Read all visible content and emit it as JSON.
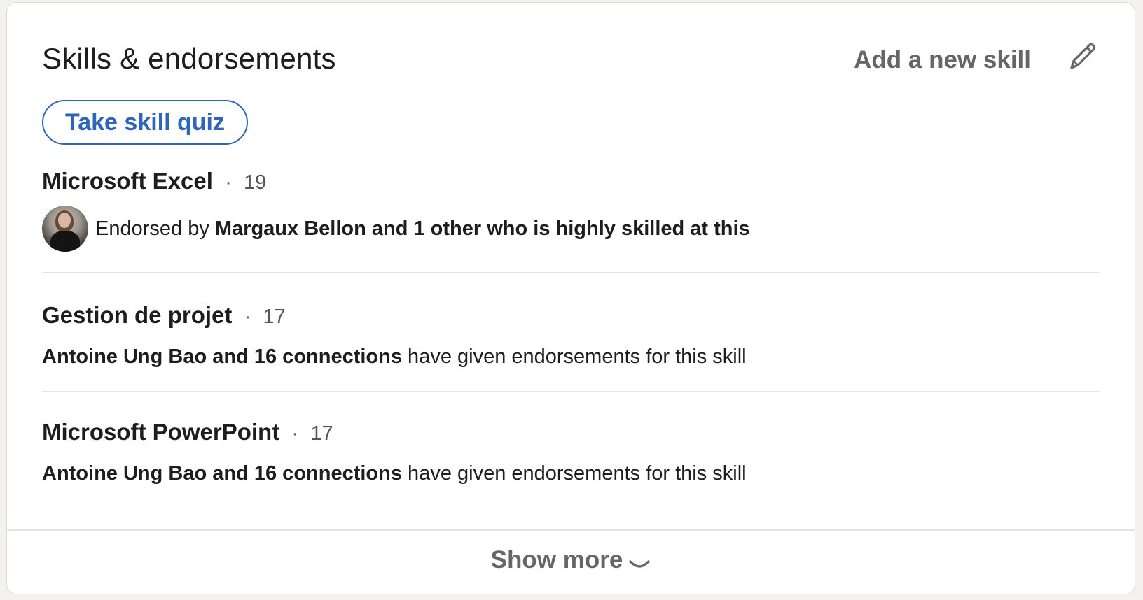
{
  "section": {
    "title": "Skills & endorsements",
    "add_skill_label": "Add a new skill",
    "edit_icon": "pencil-icon",
    "quiz_button_label": "Take skill quiz",
    "show_more_label": "Show more",
    "show_more_icon": "chevron-down-icon"
  },
  "skills": [
    {
      "name": "Microsoft Excel",
      "separator": "·",
      "count": "19",
      "endorsement": {
        "avatar": "endorser-avatar",
        "prefix": "Endorsed by ",
        "bold": "Margaux Bellon and 1 other who is highly skilled at this",
        "suffix": ""
      }
    },
    {
      "name": "Gestion de projet",
      "separator": "·",
      "count": "17",
      "endorsement": {
        "prefix": "",
        "bold": "Antoine Ung Bao and 16 connections",
        "suffix": " have given endorsements for this skill"
      }
    },
    {
      "name": "Microsoft PowerPoint",
      "separator": "·",
      "count": "17",
      "endorsement": {
        "prefix": "",
        "bold": "Antoine Ung Bao and 16 connections",
        "suffix": " have given endorsements for this skill"
      }
    }
  ],
  "colors": {
    "accent_blue": "#2d64bc",
    "text_primary": "#1d1d1d",
    "text_secondary": "#666666",
    "divider": "#e6e4e1"
  }
}
